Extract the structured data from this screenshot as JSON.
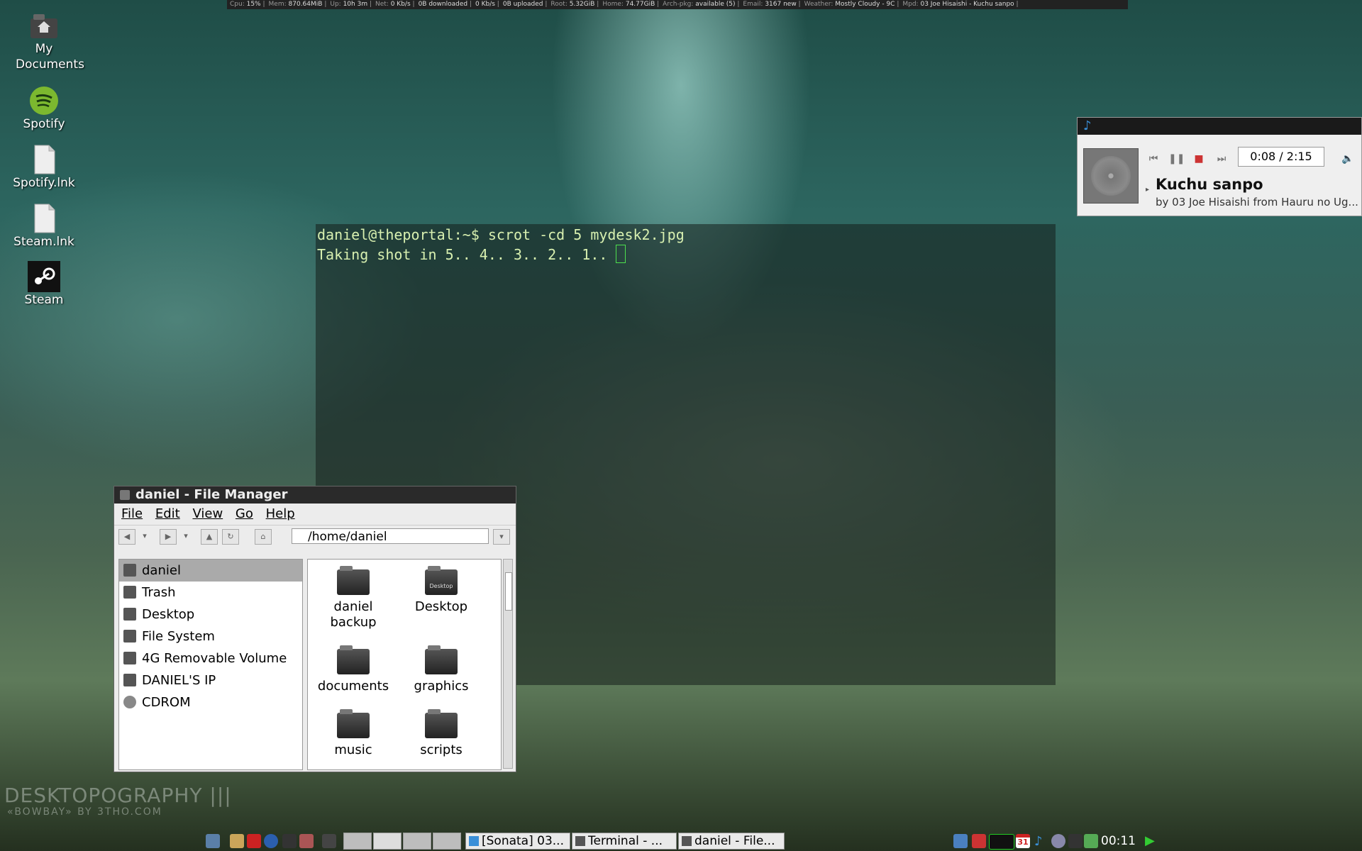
{
  "status_bar": [
    {
      "label": "Cpu:",
      "value": "15%"
    },
    {
      "label": "Mem:",
      "value": "870.64MiB"
    },
    {
      "label": "Up:",
      "value": "10h 3m"
    },
    {
      "label": "Net:",
      "value": "0 Kb/s"
    },
    {
      "label": "",
      "value": "0B downloaded"
    },
    {
      "label": "",
      "value": "0 Kb/s"
    },
    {
      "label": "",
      "value": "0B uploaded"
    },
    {
      "label": "Root:",
      "value": "5.32GiB"
    },
    {
      "label": "Home:",
      "value": "74.77GiB"
    },
    {
      "label": "Arch-pkg:",
      "value": "available (5)"
    },
    {
      "label": "Email:",
      "value": "3167 new"
    },
    {
      "label": "Weather:",
      "value": "Mostly Cloudy - 9C"
    },
    {
      "label": "Mpd:",
      "value": "03 Joe Hisaishi - Kuchu sanpo"
    }
  ],
  "desktop_icons": {
    "my_documents": "My Documents",
    "spotify": "Spotify",
    "spotify_lnk": "Spotify.lnk",
    "steam_lnk": "Steam.lnk",
    "steam": "Steam"
  },
  "terminal": {
    "line1": "daniel@theportal:~$ scrot -cd 5 mydesk2.jpg",
    "line2": "Taking shot in 5.. 4.. 3.. 2.. 1.. "
  },
  "sonata": {
    "time": "0:08 / 2:15",
    "song": "Kuchu sanpo",
    "artist": "by 03 Joe Hisaishi from Hauru no Ug..."
  },
  "file_manager": {
    "title": "daniel - File Manager",
    "menu": {
      "file": "File",
      "edit": "Edit",
      "view": "View",
      "go": "Go",
      "help": "Help"
    },
    "address": "/home/daniel",
    "sidebar": [
      "daniel",
      "Trash",
      "Desktop",
      "File System",
      "4G Removable Volume",
      "DANIEL'S IP",
      "CDROM"
    ],
    "files": {
      "daniel_backup": "daniel backup",
      "desktop": "Desktop",
      "desktop_badge": "Desktop",
      "documents": "documents",
      "graphics": "graphics",
      "music": "music",
      "scripts": "scripts"
    }
  },
  "branding": {
    "line1": "DESKTOPOGRAPHY |||",
    "line2": "«BOWBAY» BY 3THO.COM"
  },
  "taskbar": {
    "tasks": [
      "[Sonata] 03...",
      "Terminal - ...",
      "daniel - File..."
    ],
    "calendar_day": "31",
    "clock": "00:11"
  }
}
